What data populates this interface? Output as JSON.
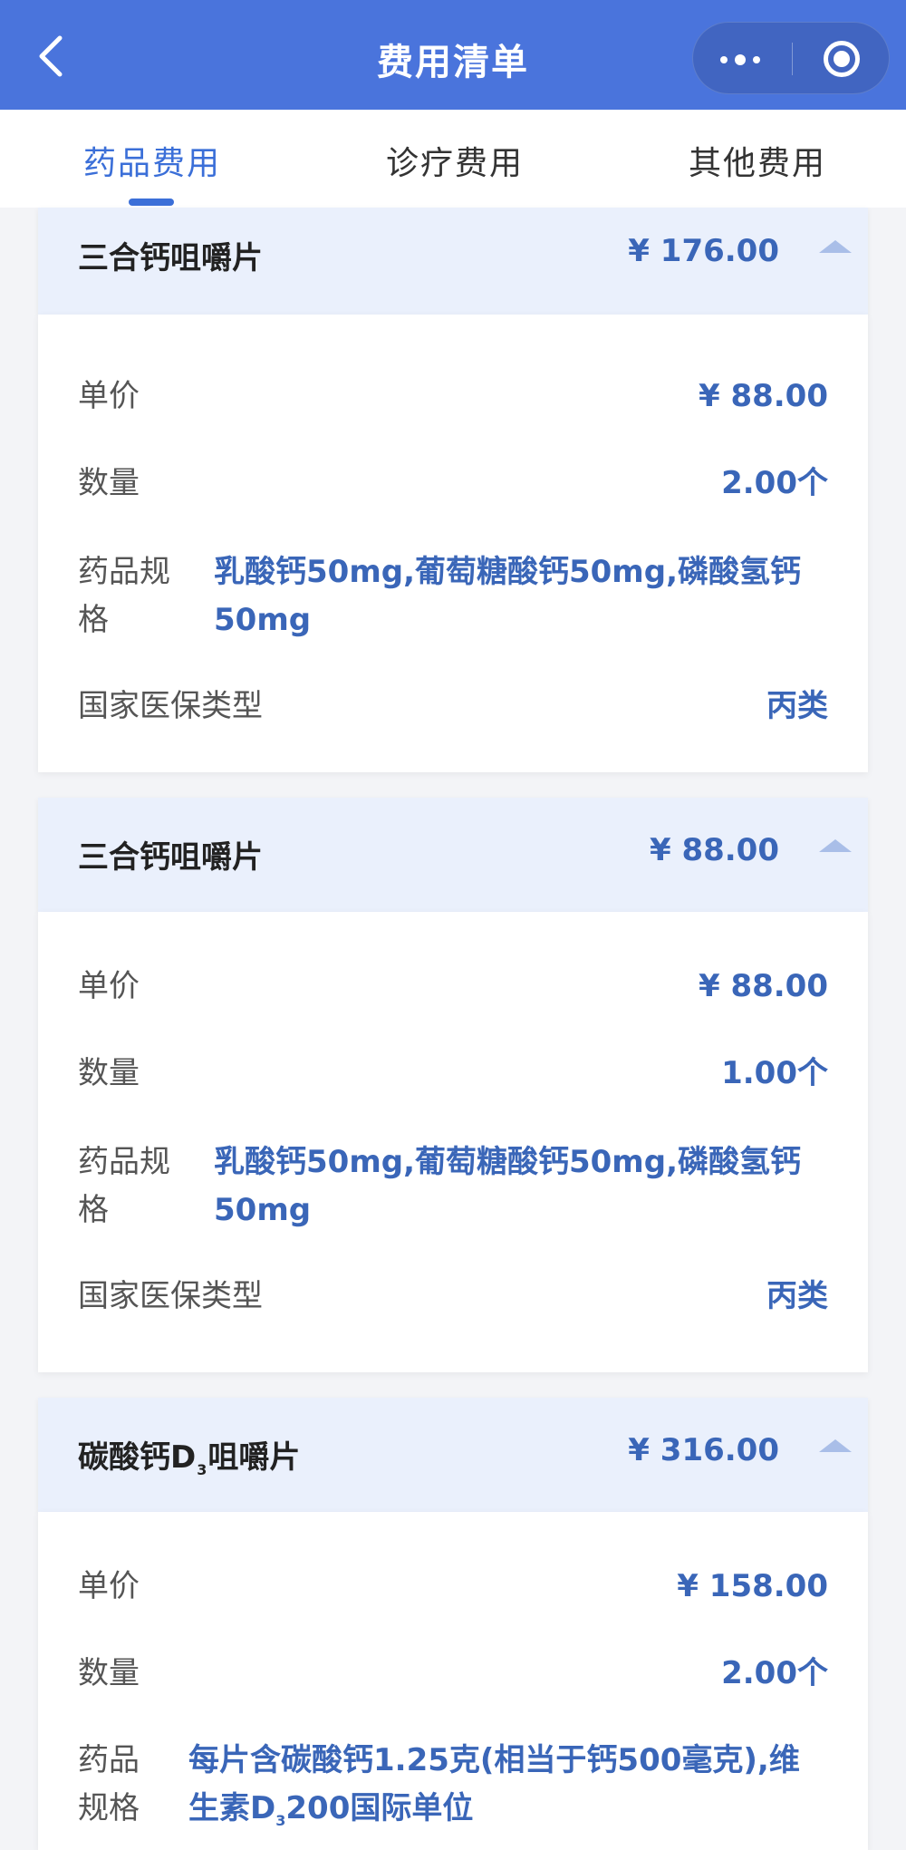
{
  "header": {
    "title": "费用清单",
    "colors": {
      "background": "#4a74dc",
      "text": "#ffffff"
    }
  },
  "tabs": [
    {
      "label": "药品费用",
      "active": true
    },
    {
      "label": "诊疗费用",
      "active": false
    },
    {
      "label": "其他费用",
      "active": false
    }
  ],
  "fields": {
    "unit_price": "单价",
    "quantity": "数量",
    "spec_line1": "药品规",
    "spec_line2": "格",
    "spec_line1_b": "药品",
    "spec_line2_b": "规格",
    "insurance_type": "国家医保类型"
  },
  "items": [
    {
      "name": "三合钙咀嚼片",
      "total": "¥ 176.00",
      "unit_price": "¥ 88.00",
      "quantity": "2.00个",
      "spec_line1": "乳酸钙50mg,葡萄糖酸钙50mg,磷酸氢钙",
      "spec_line2": "50mg",
      "insurance_type": "丙类"
    },
    {
      "name": "三合钙咀嚼片",
      "total": "¥ 88.00",
      "unit_price": "¥ 88.00",
      "quantity": "1.00个",
      "spec_line1": "乳酸钙50mg,葡萄糖酸钙50mg,磷酸氢钙",
      "spec_line2": "50mg",
      "insurance_type": "丙类"
    },
    {
      "name_prefix": "碳酸钙D",
      "name_sub": "3",
      "name_suffix": "咀嚼片",
      "total": "¥ 316.00",
      "unit_price": "¥ 158.00",
      "quantity": "2.00个",
      "spec_line1": "每片含碳酸钙1.25克(相当于钙500毫克),维",
      "spec_line2_prefix": "生素D",
      "spec_line2_sub": "3",
      "spec_line2_suffix": "200国际单位"
    }
  ],
  "colors": {
    "accent": "#3b6fd8",
    "value_text": "#3a66b8",
    "card_header_bg": "#eaf0fc",
    "page_bg": "#f3f4f7"
  },
  "icons": [
    "back-arrow-icon",
    "more-dots-icon",
    "close-target-icon",
    "collapse-arrow-icon"
  ]
}
